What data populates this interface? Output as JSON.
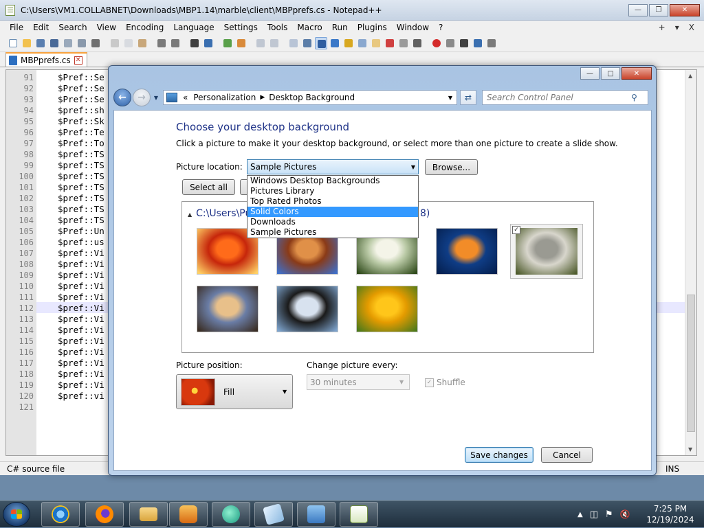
{
  "npp": {
    "title": "C:\\Users\\VM1.COLLABNET\\Downloads\\MBP1.14\\marble\\client\\MBPprefs.cs - Notepad++",
    "menu": [
      "File",
      "Edit",
      "Search",
      "View",
      "Encoding",
      "Language",
      "Settings",
      "Tools",
      "Macro",
      "Run",
      "Plugins",
      "Window",
      "?"
    ],
    "menu_right": [
      "+",
      "▾",
      "X"
    ],
    "tab_label": "MBPprefs.cs",
    "line_numbers": [
      "91",
      "92",
      "93",
      "94",
      "95",
      "96",
      "97",
      "98",
      "99",
      "100",
      "101",
      "102",
      "103",
      "104",
      "105",
      "106",
      "107",
      "108",
      "109",
      "110",
      "111",
      "112",
      "113",
      "114",
      "115",
      "116",
      "117",
      "118",
      "119",
      "120",
      "121"
    ],
    "code_lines": [
      "$Pref::Se",
      "$Pref::Se",
      "$Pref::Se",
      "$pref::sh",
      "$Pref::Sk",
      "$Pref::Te",
      "$Pref::To",
      "$pref::TS",
      "$pref::TS",
      "$pref::TS",
      "$pref::TS",
      "$pref::TS",
      "$pref::TS",
      "$pref::TS",
      "$Pref::Un",
      "$pref::us",
      "$pref::Vi",
      "$pref::Vi",
      "$pref::Vi",
      "$pref::Vi",
      "$pref::Vi",
      "$pref::Vi",
      "$pref::Vi",
      "$pref::Vi",
      "$pref::Vi",
      "$pref::Vi",
      "$pref::Vi",
      "$pref::Vi",
      "$pref::Vi",
      "$pref::vi",
      ""
    ],
    "status_lang": "C# source file",
    "status_ins": "INS"
  },
  "cp": {
    "breadcrumb_prefix": "«",
    "breadcrumb": [
      "Personalization",
      "Desktop Background"
    ],
    "search_placeholder": "Search Control Panel",
    "heading": "Choose your desktop background",
    "subtitle": "Click a picture to make it your desktop background, or select more than one picture to create a slide show.",
    "location_label": "Picture location:",
    "location_value": "Sample Pictures",
    "location_options": [
      {
        "label": "Windows Desktop Backgrounds",
        "selected": false
      },
      {
        "label": "Pictures Library",
        "selected": false
      },
      {
        "label": "Top Rated Photos",
        "selected": false
      },
      {
        "label": "Solid Colors",
        "selected": true
      },
      {
        "label": "Downloads",
        "selected": false
      },
      {
        "label": "Sample Pictures",
        "selected": false
      }
    ],
    "browse_label": "Browse...",
    "select_all_label": "Select all",
    "group_label": "C:\\Users\\Pu",
    "group_label_tail": "8)",
    "thumbnails": [
      {
        "name": "chrysanthemum",
        "checked": false,
        "colors": [
          "#ff6b1a",
          "#c6260b",
          "#ffd166"
        ]
      },
      {
        "name": "desert",
        "checked": false,
        "colors": [
          "#e09048",
          "#8a3a17",
          "#3f6ec7"
        ]
      },
      {
        "name": "hydrangeas",
        "checked": false,
        "colors": [
          "#f4f4e8",
          "#b9c9a5",
          "#2f4a1a"
        ]
      },
      {
        "name": "jellyfish",
        "checked": false,
        "colors": [
          "#f28c28",
          "#0f3d86",
          "#052050"
        ]
      },
      {
        "name": "koala",
        "checked": true,
        "colors": [
          "#9a9a92",
          "#d8d6cc",
          "#4d5a2b"
        ]
      },
      {
        "name": "lighthouse",
        "checked": false,
        "colors": [
          "#e8c08a",
          "#6a7da6",
          "#3a2d23"
        ]
      },
      {
        "name": "penguins",
        "checked": false,
        "colors": [
          "#d8e2ef",
          "#1a1a1a",
          "#7da3cc"
        ]
      },
      {
        "name": "tulips",
        "checked": false,
        "colors": [
          "#ffc61a",
          "#e49b00",
          "#4d7a1a"
        ]
      }
    ],
    "position_label": "Picture position:",
    "position_value": "Fill",
    "change_label": "Change picture every:",
    "change_value": "30 minutes",
    "shuffle_label": "Shuffle",
    "save_label": "Save changes",
    "cancel_label": "Cancel"
  },
  "taskbar": {
    "time": "7:25 PM",
    "date": "12/19/2024"
  },
  "colors": {
    "heading": "#1e3287",
    "dropdown_highlight": "#3399ff",
    "tab_accent": "#f9a23c"
  }
}
